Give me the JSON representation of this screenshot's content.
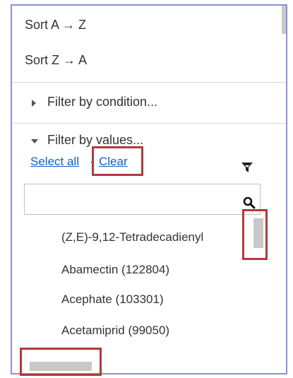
{
  "menu": {
    "sort_az": "Sort A → Z",
    "sort_za": "Sort Z → A"
  },
  "filter_condition": {
    "label": "Filter by condition...",
    "icon": "chevron-right-icon",
    "expanded": false
  },
  "filter_values": {
    "label": "Filter by values...",
    "icon": "chevron-down-icon",
    "expanded": true,
    "select_all_label": "Select all",
    "separator": "·",
    "clear_label": "Clear",
    "funnel_icon": "filter-funnel-icon",
    "search": {
      "value": "",
      "placeholder": "",
      "icon": "search-icon"
    },
    "items": [
      "(Z,E)-9,12-Tetradecadienyl",
      "Abamectin (122804)",
      "Acephate (103301)",
      "Acetamiprid (99050)"
    ]
  },
  "colors": {
    "frame_border": "#8b8fe0",
    "highlight_box": "#b03a3a",
    "link": "#1a5ccf",
    "scroll_thumb": "#c8c8c8"
  }
}
